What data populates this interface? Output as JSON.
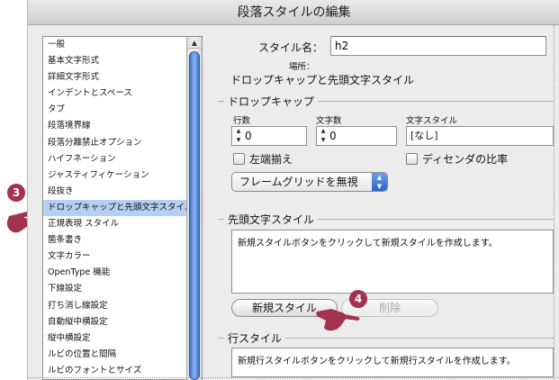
{
  "window": {
    "title": "段落スタイルの編集"
  },
  "sidebar": {
    "items": [
      "一般",
      "基本文字形式",
      "詳細文字形式",
      "インデントとスペース",
      "タブ",
      "段落境界線",
      "段落分離禁止オプション",
      "ハイフネーション",
      "ジャスティフィケーション",
      "段抜き",
      "ドロップキャップと先頭文字スタイル",
      "正規表現 スタイル",
      "箇条書き",
      "文字カラー",
      "OpenType 機能",
      "下線設定",
      "打ち消し線設定",
      "自動縦中横設定",
      "縦中横設定",
      "ルビの位置と間隔",
      "ルビのフォントとサイズ"
    ],
    "selected_index": 10,
    "scroll_up_glyph": "▲"
  },
  "style_name": {
    "label": "スタイル名：",
    "value": "h2"
  },
  "location": {
    "label": "場所：",
    "value": "ドロップキャップと先頭文字スタイル"
  },
  "drop_cap": {
    "title": "ドロップキャップ",
    "lines_label": "行数",
    "lines_value": "0",
    "chars_label": "文字数",
    "chars_value": "0",
    "char_style_label": "文字スタイル",
    "char_style_value": "[なし]",
    "align_left_label": "左端揃え",
    "descender_label": "ディセンダの比率",
    "frame_grid_value": "フレームグリッドを無視",
    "stepper_up": "▲",
    "stepper_down": "▼"
  },
  "nested_styles": {
    "title": "先頭文字スタイル",
    "message": "新規スタイルボタンをクリックして新規スタイルを作成します。",
    "new_button": "新規スタイル",
    "delete_button": "削除"
  },
  "line_styles": {
    "title": "行スタイル",
    "message": "新規行スタイルボタンをクリックして新規行スタイルを作成します。"
  },
  "annotations": {
    "step3": "3",
    "step4": "4"
  },
  "colors": {
    "badge": "#a3324d",
    "selection": "#b5d0f2",
    "accent": "#2f63c4"
  }
}
